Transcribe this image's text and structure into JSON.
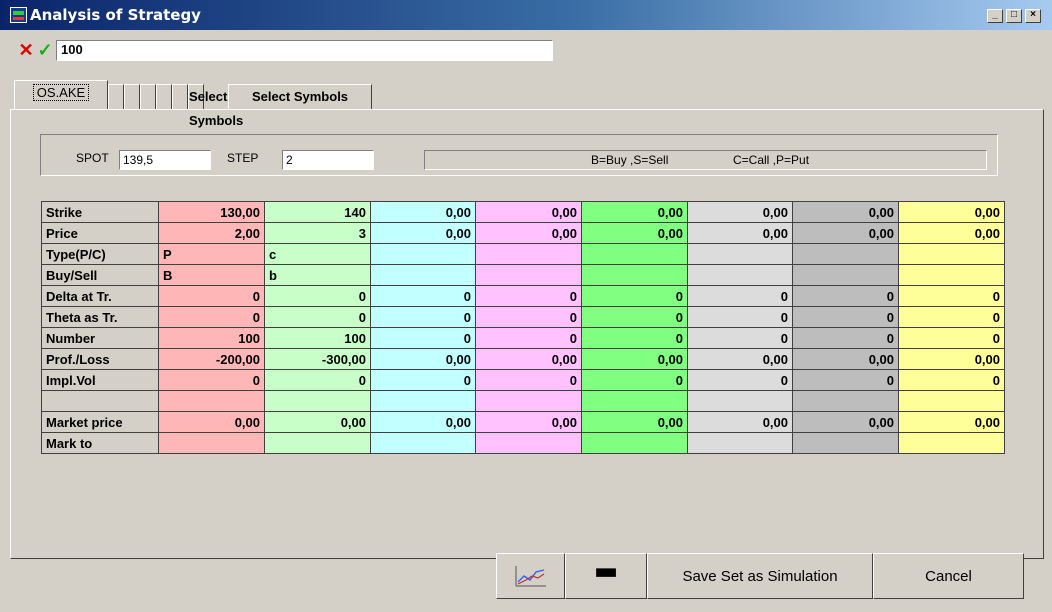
{
  "window": {
    "title": "Analysis of Strategy"
  },
  "input_bar": {
    "value": "100"
  },
  "tabs": [
    "OS.AKE",
    "",
    "",
    "",
    "",
    "",
    "Select Symbols"
  ],
  "spot": {
    "label": "SPOT",
    "value": "139,5"
  },
  "step": {
    "label": "STEP",
    "value": "2"
  },
  "legend": {
    "buy_sell": "B=Buy ,S=Sell",
    "call_put": "C=Call ,P=Put"
  },
  "column_colors": [
    "#ffb6b6",
    "#c8ffc8",
    "#c2ffff",
    "#ffc2ff",
    "#80ff80",
    "#dcdcdc",
    "#bdbdbd",
    "#ffff99"
  ],
  "rows": [
    {
      "label": "Strike",
      "cells": [
        "130,00",
        "140",
        "0,00",
        "0,00",
        "0,00",
        "0,00",
        "0,00",
        "0,00"
      ]
    },
    {
      "label": "Price",
      "cells": [
        "2,00",
        "3",
        "0,00",
        "0,00",
        "0,00",
        "0,00",
        "0,00",
        "0,00"
      ]
    },
    {
      "label": "Type(P/C)",
      "cells": [
        "P",
        "c",
        "",
        "",
        "",
        "",
        "",
        ""
      ]
    },
    {
      "label": "Buy/Sell",
      "cells": [
        "B",
        "b",
        "",
        "",
        "",
        "",
        "",
        ""
      ]
    },
    {
      "label": "Delta at Tr.",
      "cells": [
        "0",
        "0",
        "0",
        "0",
        "0",
        "0",
        "0",
        "0"
      ]
    },
    {
      "label": "Theta as Tr.",
      "cells": [
        "0",
        "0",
        "0",
        "0",
        "0",
        "0",
        "0",
        "0"
      ]
    },
    {
      "label": "Number",
      "cells": [
        "100",
        "100",
        "0",
        "0",
        "0",
        "0",
        "0",
        "0"
      ]
    },
    {
      "label": "Prof./Loss",
      "cells": [
        "-200,00",
        "-300,00",
        "0,00",
        "0,00",
        "0,00",
        "0,00",
        "0,00",
        "0,00"
      ]
    },
    {
      "label": "Impl.Vol",
      "cells": [
        "0",
        "0",
        "0",
        "0",
        "0",
        "0",
        "0",
        "0"
      ]
    },
    {
      "label": "",
      "cells": [
        "",
        "",
        "",
        "",
        "",
        "",
        "",
        ""
      ]
    },
    {
      "label": "Market price",
      "cells": [
        "0,00",
        "0,00",
        "0,00",
        "0,00",
        "0,00",
        "0,00",
        "0,00",
        "0,00"
      ]
    },
    {
      "label": "Mark to",
      "cells": [
        "",
        "",
        "",
        "",
        "",
        "",
        "",
        ""
      ]
    }
  ],
  "buttons": {
    "chart_icon": "chart-icon",
    "binoculars_icon": "binoculars-icon",
    "save_set": "Save Set as Simulation",
    "cancel": "Cancel"
  }
}
